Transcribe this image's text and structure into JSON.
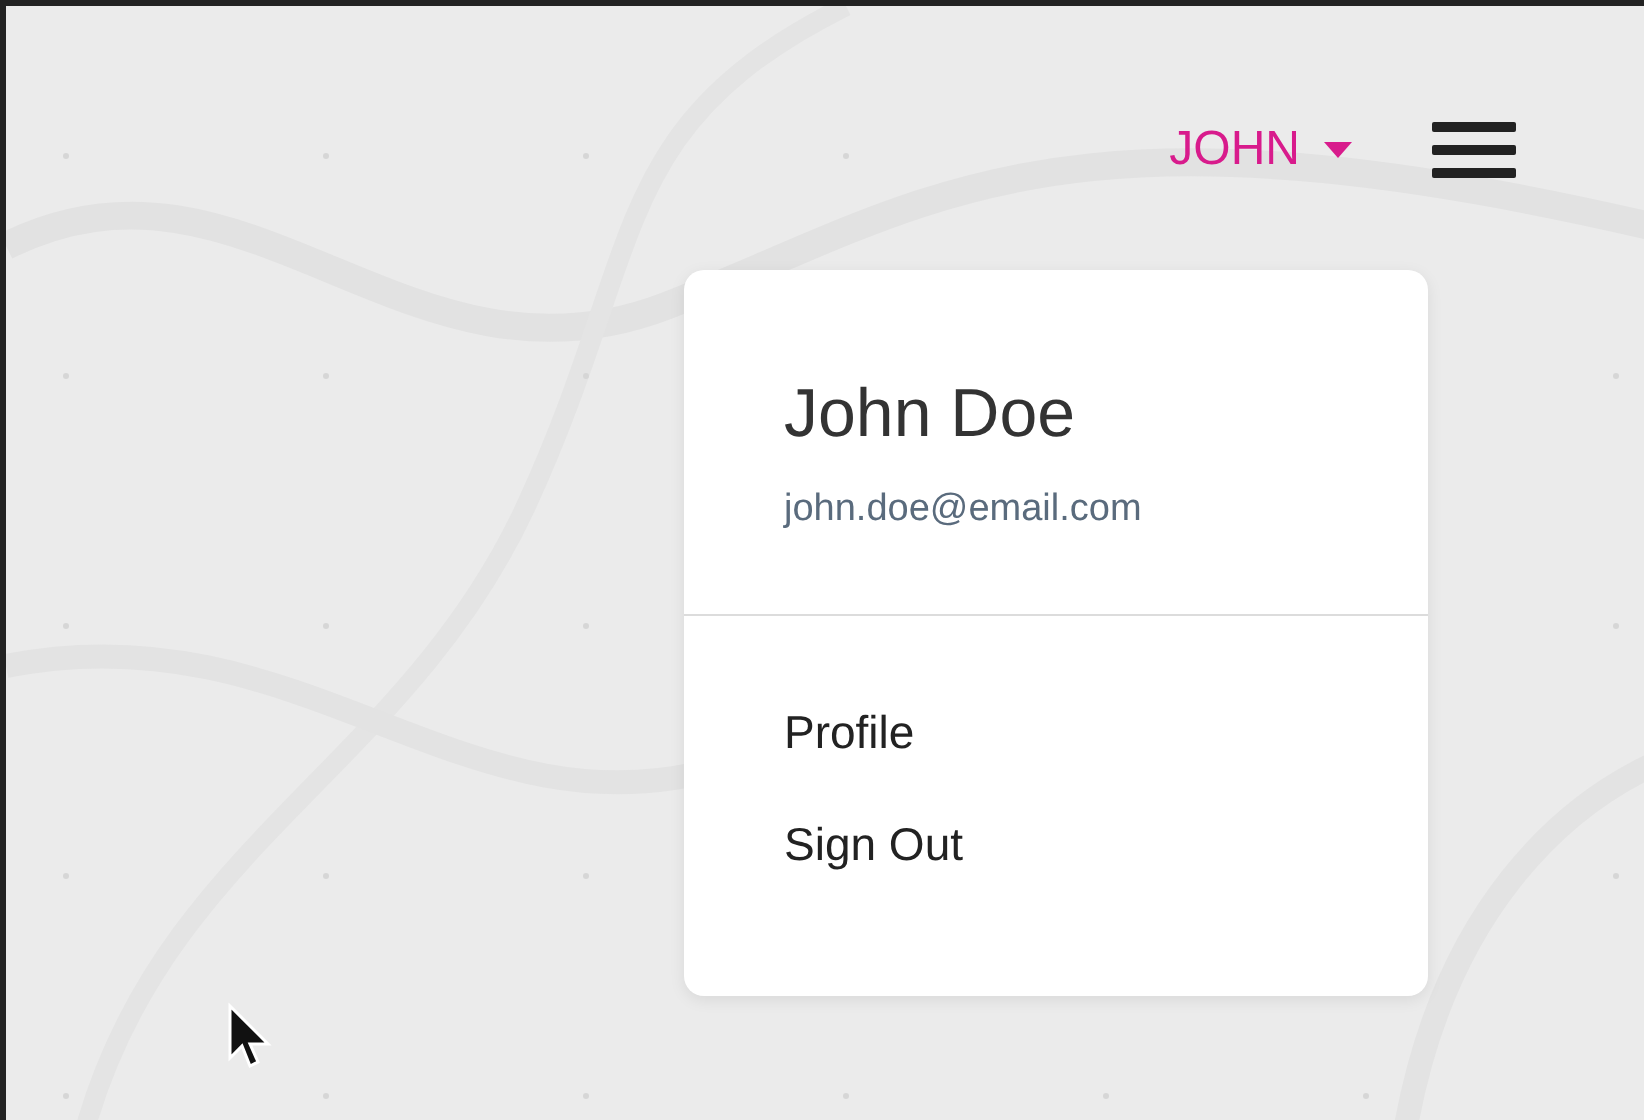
{
  "header": {
    "user_menu": {
      "label": "JOHN",
      "expanded": true
    }
  },
  "dropdown": {
    "name": "John Doe",
    "email": "john.doe@email.com",
    "items": [
      {
        "label": "Profile"
      },
      {
        "label": "Sign Out"
      }
    ]
  }
}
